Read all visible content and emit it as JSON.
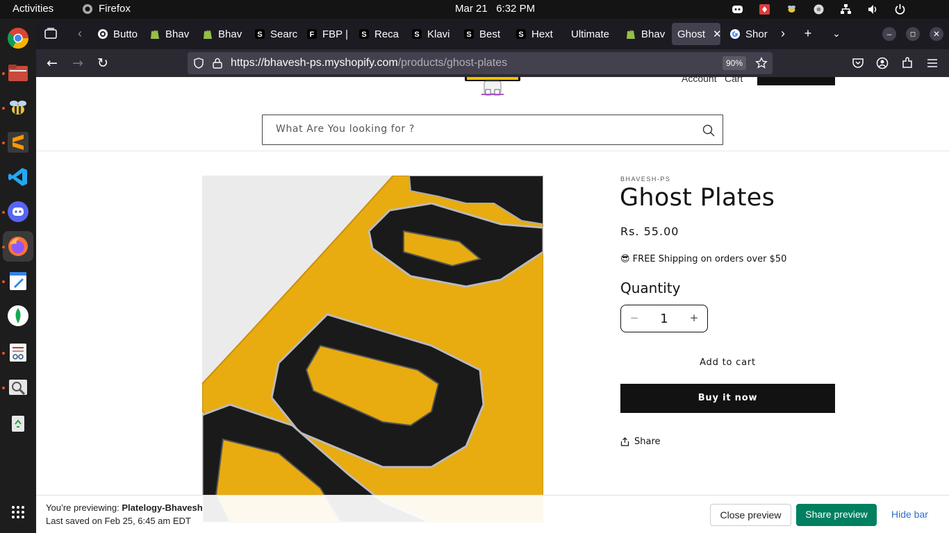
{
  "topbar": {
    "activities": "Activities",
    "app_name": "Firefox",
    "date": "Mar 21",
    "time": "6:32 PM"
  },
  "browser": {
    "tabs": [
      {
        "label": "Butto",
        "icon": "circle-icon"
      },
      {
        "label": "Bhav",
        "icon": "shopify-icon"
      },
      {
        "label": "Bhav",
        "icon": "shopify-icon"
      },
      {
        "label": "Searc",
        "icon": "s-icon"
      },
      {
        "label": "FBP |",
        "icon": "s-icon"
      },
      {
        "label": "Reca",
        "icon": "s-icon"
      },
      {
        "label": "Klavi",
        "icon": "s-icon"
      },
      {
        "label": "Best",
        "icon": "s-icon"
      },
      {
        "label": "Hext",
        "icon": "s-icon"
      },
      {
        "label": "Ultimate",
        "icon": "none"
      },
      {
        "label": "Bhav",
        "icon": "shopify-icon"
      },
      {
        "label": "Ghost",
        "icon": "none",
        "active": true
      },
      {
        "label": "Shor",
        "icon": "google-icon"
      }
    ],
    "url_host": "https://bhavesh-ps.myshopify.com",
    "url_path": "/products/ghost-plates",
    "zoom": "90%"
  },
  "store": {
    "header_links": [
      "Account",
      "Cart"
    ],
    "search_placeholder": "What Are You looking for ?"
  },
  "product": {
    "vendor": "BHAVESH-PS",
    "title": "Ghost Plates",
    "price": "Rs. 55.00",
    "shipping_note": "😎 FREE Shipping on orders over $50",
    "quantity_label": "Quantity",
    "quantity_value": "1",
    "minus": "−",
    "plus": "+",
    "add_to_cart": "Add to cart",
    "buy_now": "Buy it now",
    "share": "Share"
  },
  "preview_bar": {
    "previewing_prefix": "You’re previewing:",
    "theme_name": "Platelogy-Bhavesh",
    "last_saved": "Last saved on Feb 25, 6:45 am EDT",
    "close_preview": "Close preview",
    "share_preview": "Share preview",
    "hide_bar": "Hide bar"
  },
  "colors": {
    "accent_green": "#008060",
    "plate_yellow": "#e8ac10",
    "button_black": "#121212"
  }
}
